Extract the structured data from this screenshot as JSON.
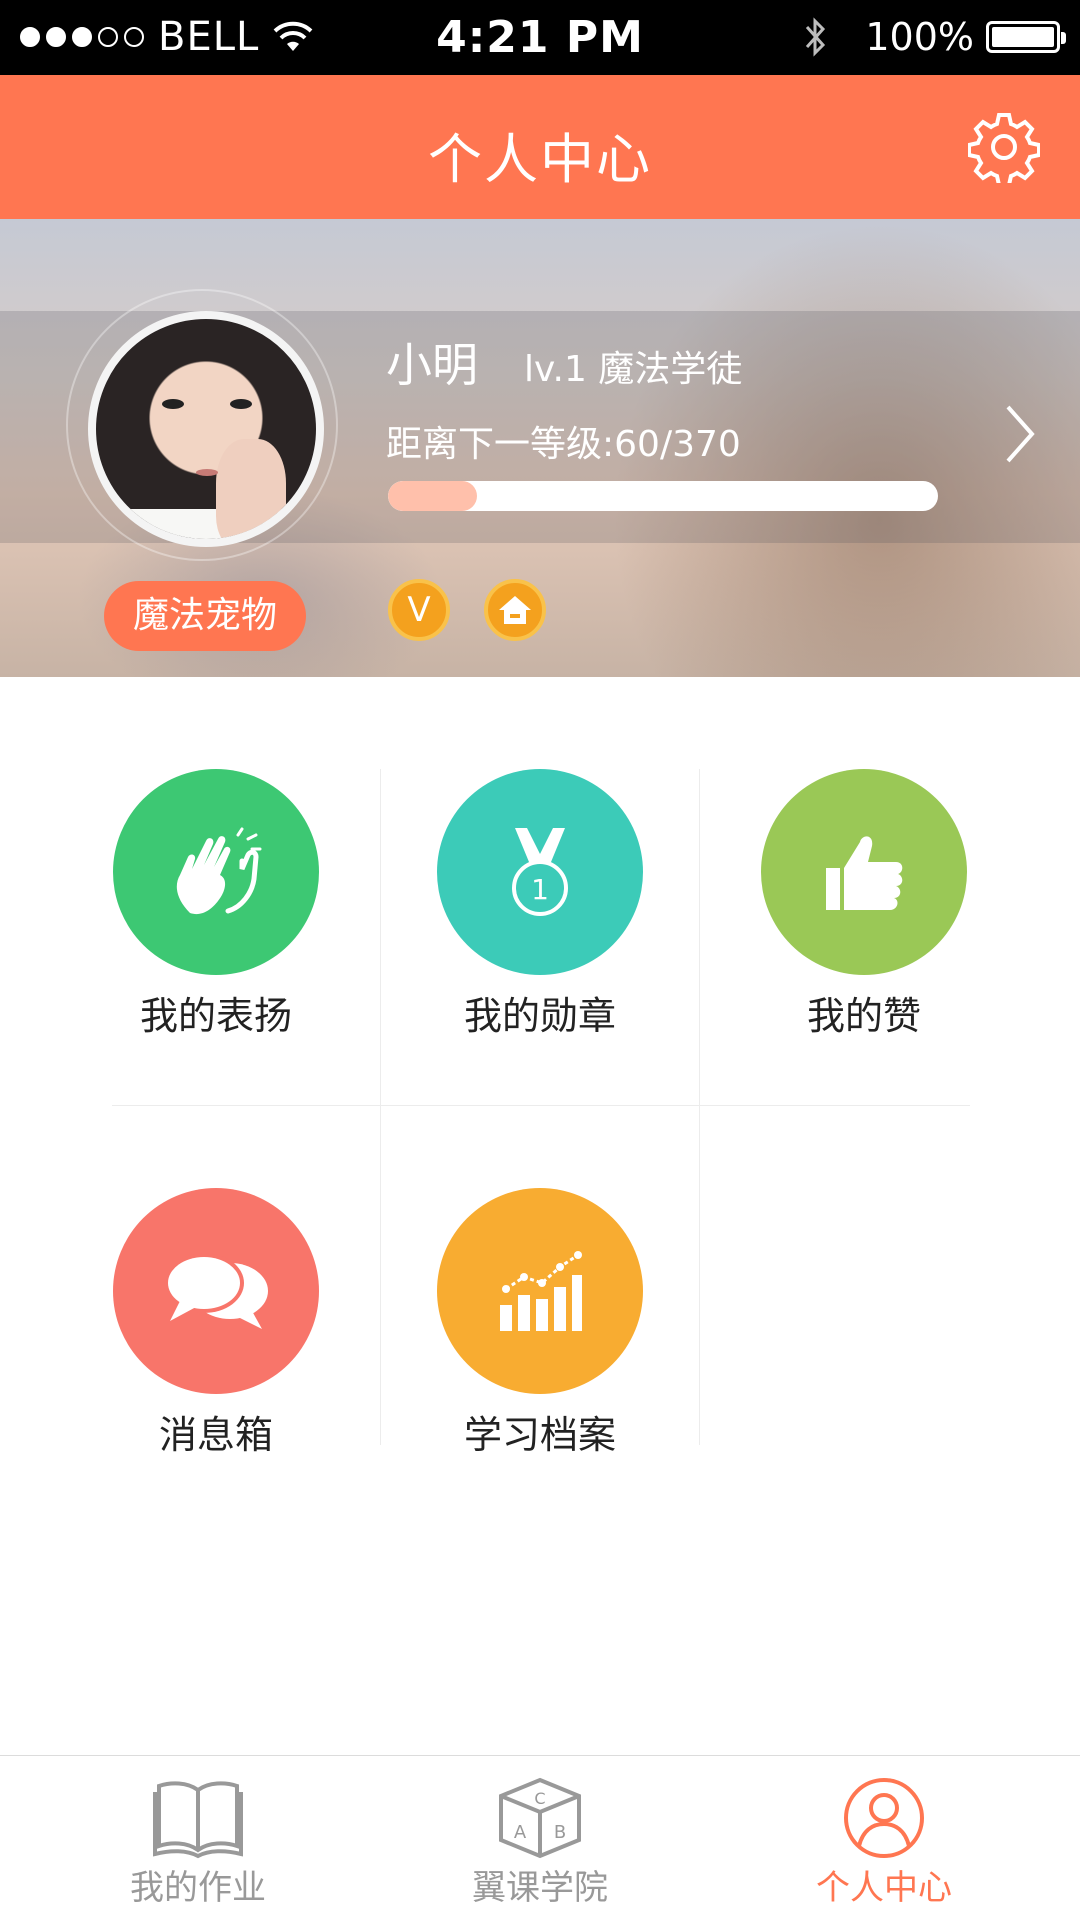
{
  "status_bar": {
    "carrier": "BELL",
    "time": "4:21 PM",
    "battery": "100%"
  },
  "header": {
    "title": "个人中心",
    "settings_icon": "gear-icon"
  },
  "profile": {
    "name": "小明",
    "level": "lv.1 魔法学徒",
    "progress_text": "距离下一等级:60/370",
    "progress_current": 60,
    "progress_total": 370,
    "pet_button": "魔法宠物",
    "badges": [
      {
        "icon": "v-badge-icon",
        "text": "V"
      },
      {
        "icon": "house-badge-icon"
      }
    ]
  },
  "menu": [
    {
      "label": "我的表扬",
      "icon": "clapping-hands-icon",
      "color": "#3dc873"
    },
    {
      "label": "我的勋章",
      "icon": "medal-icon",
      "color": "#3ccbb8"
    },
    {
      "label": "我的赞",
      "icon": "thumbs-up-icon",
      "color": "#9ac856"
    },
    {
      "label": "消息箱",
      "icon": "chat-bubbles-icon",
      "color": "#f8756a"
    },
    {
      "label": "学习档案",
      "icon": "bar-chart-icon",
      "color": "#f8ac31"
    }
  ],
  "tabs": [
    {
      "label": "我的作业",
      "icon": "book-icon",
      "active": false
    },
    {
      "label": "翼课学院",
      "icon": "abc-cube-icon",
      "active": false
    },
    {
      "label": "个人中心",
      "icon": "user-icon",
      "active": true
    }
  ],
  "colors": {
    "accent": "#ff7651",
    "badge": "#f4a11e"
  }
}
